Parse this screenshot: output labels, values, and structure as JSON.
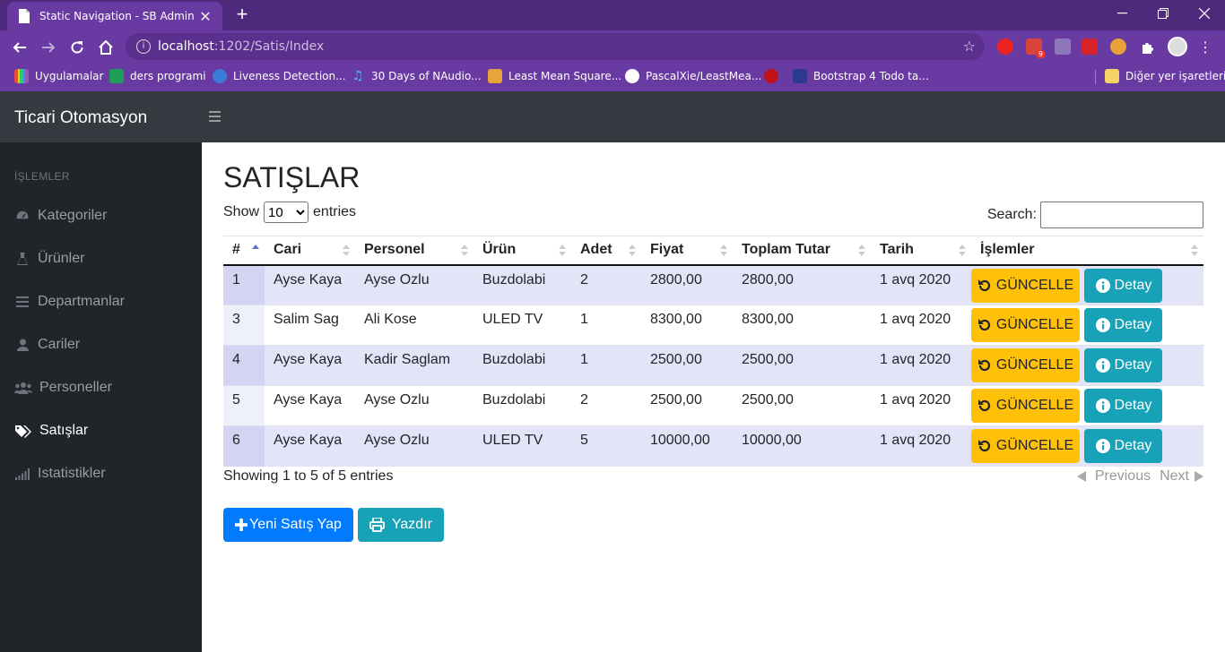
{
  "browser": {
    "tab_title": "Static Navigation - SB Admin",
    "url_host": "localhost",
    "url_path": ":1202/Satis/Index",
    "mail_badge": "9",
    "bookmarks": [
      {
        "label": "Uygulamalar",
        "icon": "apps-grid-icon"
      },
      {
        "label": "ders programi",
        "icon": "sheets-icon"
      },
      {
        "label": "Liveness Detection...",
        "icon": "pyimagesearch-icon"
      },
      {
        "label": "30 Days of NAudio...",
        "icon": "music-note-icon"
      },
      {
        "label": "Least Mean Square...",
        "icon": "site-icon"
      },
      {
        "label": "PascalXie/LeastMea...",
        "icon": "github-icon"
      },
      {
        "label": "",
        "icon": "red-circle-icon"
      },
      {
        "label": "Bootstrap 4 Todo ta...",
        "icon": "bootstrap-icon"
      }
    ],
    "other_bookmarks": "Diğer yer işaretleri"
  },
  "app": {
    "brand": "Ticari Otomasyon",
    "sidebar": {
      "heading": "İŞLEMLER",
      "items": [
        {
          "label": "Kategoriler",
          "icon": "tachometer-icon"
        },
        {
          "label": "Ürünler",
          "icon": "flask-icon"
        },
        {
          "label": "Departmanlar",
          "icon": "bars-icon"
        },
        {
          "label": "Cariler",
          "icon": "user-icon"
        },
        {
          "label": "Personeller",
          "icon": "users-icon"
        },
        {
          "label": "Satışlar",
          "icon": "tags-icon",
          "active": true
        },
        {
          "label": "Istatistikler",
          "icon": "signal-icon"
        }
      ]
    },
    "page_title": "SATIŞLAR",
    "length": {
      "show": "Show",
      "value": "10",
      "entries": "entries"
    },
    "search_label": "Search:",
    "table": {
      "headers": [
        "#",
        "Cari",
        "Personel",
        "Ürün",
        "Adet",
        "Fiyat",
        "Toplam Tutar",
        "Tarih",
        "İşlemler"
      ],
      "rows": [
        [
          "1",
          "Ayse Kaya",
          "Ayse Ozlu",
          "Buzdolabi",
          "2",
          "2800,00",
          "2800,00",
          "1 avq 2020"
        ],
        [
          "3",
          "Salim Sag",
          "Ali Kose",
          "ULED TV",
          "1",
          "8300,00",
          "8300,00",
          "1 avq 2020"
        ],
        [
          "4",
          "Ayse Kaya",
          "Kadir Saglam",
          "Buzdolabi",
          "1",
          "2500,00",
          "2500,00",
          "1 avq 2020"
        ],
        [
          "5",
          "Ayse Kaya",
          "Ayse Ozlu",
          "Buzdolabi",
          "2",
          "2500,00",
          "2500,00",
          "1 avq 2020"
        ],
        [
          "6",
          "Ayse Kaya",
          "Ayse Ozlu",
          "ULED TV",
          "5",
          "10000,00",
          "10000,00",
          "1 avq 2020"
        ]
      ],
      "update_label": "GÜNCELLE",
      "detail_label": "Detay"
    },
    "info": "Showing 1 to 5 of 5 entries",
    "pager": {
      "previous": "Previous",
      "next": "Next"
    },
    "buttons": {
      "new_sale": "Yeni Satış Yap",
      "print": "Yazdır"
    }
  },
  "colors": {
    "chrome_purple": "#6a3aa3",
    "topnav": "#343a40",
    "sidebar": "#212529",
    "warning": "#ffc107",
    "info": "#17a2b8",
    "primary": "#007bff"
  }
}
